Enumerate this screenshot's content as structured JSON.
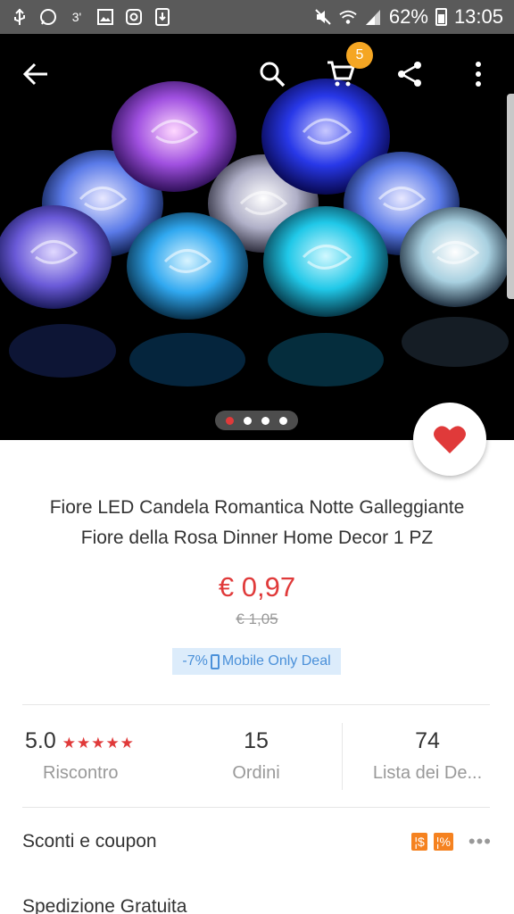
{
  "status_bar": {
    "left_icons": [
      "usb-icon",
      "whatsapp-icon",
      "3-notification-icon",
      "gallery-icon",
      "instagram-icon",
      "download-icon"
    ],
    "battery": "62%",
    "time": "13:05"
  },
  "topbar": {
    "icons": [
      "back-arrow-icon",
      "search-icon",
      "cart-icon",
      "share-icon",
      "more-vert-icon"
    ],
    "cart_count": "5"
  },
  "gallery": {
    "image_description_count": 4,
    "active_index": 0
  },
  "product": {
    "title_line1": "Fiore LED Candela Romantica Notte Galleggiante",
    "title_line2": "Fiore della Rosa Dinner Home Decor 1 PZ",
    "price": "€ 0,97",
    "old_price": "€ 1,05",
    "deal_discount": "-7%",
    "deal_label": "Mobile Only Deal"
  },
  "stats": {
    "rating_value": "5.0",
    "rating_stars": "★★★★★",
    "rating_label": "Riscontro",
    "orders_value": "15",
    "orders_label": "Ordini",
    "wishlist_value": "74",
    "wishlist_label": "Lista dei De..."
  },
  "sections": {
    "coupons_label": "Sconti e coupon",
    "coupon_tag1": "$",
    "coupon_tag2": "%",
    "more_dots": "•••",
    "shipping_label": "Spedizione Gratuita"
  },
  "colors": {
    "accent_red": "#e03a3a",
    "badge_orange": "#f5a623",
    "deal_blue": "#4a90d9"
  }
}
